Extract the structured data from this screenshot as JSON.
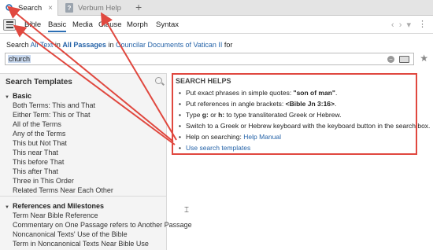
{
  "tabs": [
    {
      "label": "Search",
      "close": "×"
    },
    {
      "label": "Verbum Help",
      "close": "×"
    }
  ],
  "new_tab": "+",
  "book_icon_glyph": "?",
  "search_tabs": [
    "Bible",
    "Basic",
    "Media",
    "Clause",
    "Morph",
    "Syntax"
  ],
  "search_line": {
    "prefix": "Search ",
    "all_text": "All Text",
    "in1": " in ",
    "all_passages": "All Passages",
    "in2": " in ",
    "collection": "Councilar Documents of Vatican II",
    "for": " for"
  },
  "query": {
    "value": "church"
  },
  "left_panel": {
    "title": "Search Templates",
    "groups": [
      {
        "label": "Basic",
        "items": [
          "Both Terms: This and That",
          "Either Term: This or That",
          "All of the Terms",
          "Any of the Terms",
          "This but Not That",
          "This near That",
          "This before That",
          "This after That",
          "Three in This Order",
          "Related Terms Near Each Other"
        ]
      },
      {
        "label": "References and Milestones",
        "items": [
          "Term Near Bible Reference",
          "Commentary on One Passage refers to Another Passage",
          "Noncanonical Texts' Use of the Bible",
          "Term in Noncanonical Texts Near Bible Use"
        ]
      }
    ]
  },
  "helps": {
    "title": "SEARCH HELPS",
    "bullets": [
      {
        "pre": "Put exact phrases in simple quotes: ",
        "bold": "\"son of man\"",
        "post": "."
      },
      {
        "pre": "Put references in angle brackets: ",
        "bold": "<Bible Jn 3:16>",
        "post": "."
      },
      {
        "pre": "Type ",
        "bold": "g:",
        "mid": " or ",
        "bold2": "h:",
        "post": " to type transliterated Greek or Hebrew."
      },
      {
        "pre": "Switch to a Greek or Hebrew keyboard with the keyboard button in the search box."
      },
      {
        "pre": "Help on searching: ",
        "link": "Help Manual"
      },
      {
        "link": "Use search templates"
      }
    ]
  },
  "colors": {
    "accent": "#2c6fb4",
    "link": "#2563a8",
    "annotation": "#e0483f"
  }
}
